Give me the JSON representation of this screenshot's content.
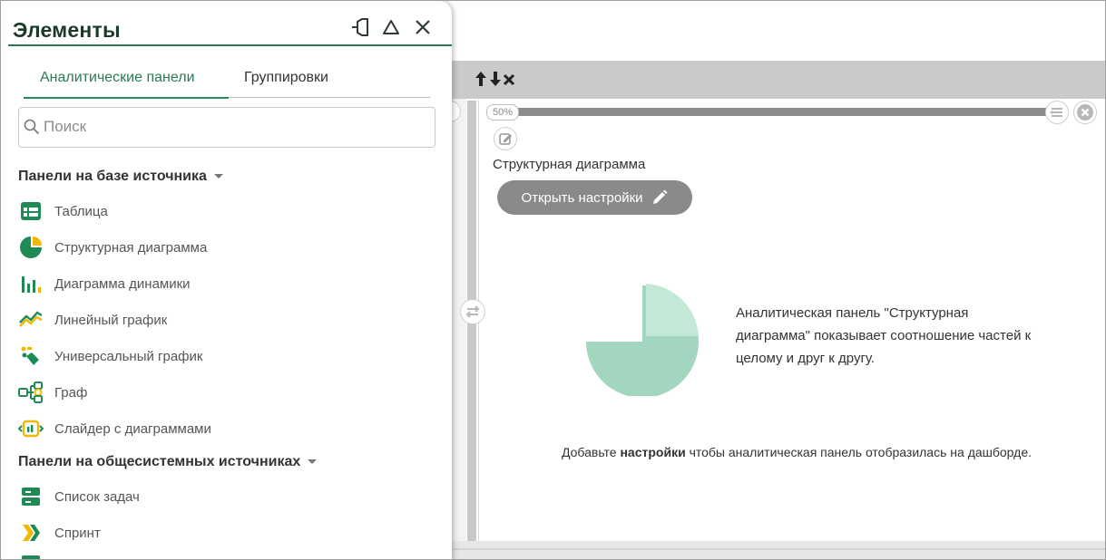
{
  "popup": {
    "title": "Элементы",
    "tabs": [
      {
        "label": "Аналитические панели",
        "active": true
      },
      {
        "label": "Группировки",
        "active": false
      }
    ],
    "search": {
      "placeholder": "Поиск",
      "value": ""
    },
    "sections": [
      {
        "title": "Панели на базе источника",
        "items": [
          {
            "label": "Таблица",
            "icon": "table-icon"
          },
          {
            "label": "Структурная диаграмма",
            "icon": "pie-chart-icon"
          },
          {
            "label": "Диаграмма динамики",
            "icon": "bar-chart-icon"
          },
          {
            "label": "Линейный график",
            "icon": "line-chart-icon"
          },
          {
            "label": "Универсальный график",
            "icon": "universal-chart-icon"
          },
          {
            "label": "Граф",
            "icon": "graph-icon"
          },
          {
            "label": "Слайдер с диаграммами",
            "icon": "slider-icon"
          }
        ]
      },
      {
        "title": "Панели на общесистемных источниках",
        "items": [
          {
            "label": "Список задач",
            "icon": "task-list-icon"
          },
          {
            "label": "Спринт",
            "icon": "sprint-icon"
          }
        ]
      }
    ]
  },
  "panel": {
    "zoom": "50%",
    "title": "Структурная диаграмма",
    "settings_button": "Открыть настройки",
    "description": "Аналитическая панель \"Структурная диаграмма\" показывает соотношение частей к целому и друг к другу.",
    "hint": {
      "prefix": "Добавьте ",
      "bold": "настройки",
      "suffix": " чтобы аналитическая панель отобразилась на дашборде."
    }
  },
  "colors": {
    "accent": "#2a7a52",
    "icon_green": "#1f8a54",
    "icon_yellow": "#f2b705",
    "pie_light": "#c4e8d6",
    "pie_main": "#a3d6bf",
    "button_grey": "#8a8a8a",
    "toolbar_grey": "#cacaca"
  }
}
